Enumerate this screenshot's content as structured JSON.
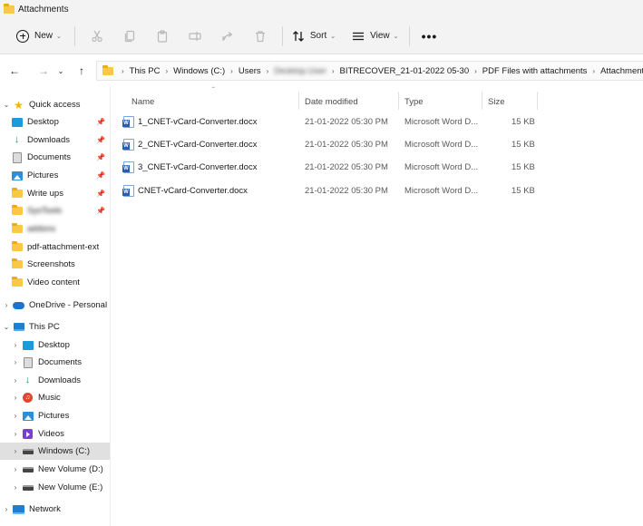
{
  "window": {
    "title": "Attachments"
  },
  "commandbar": {
    "new_label": "New",
    "sort_label": "Sort",
    "view_label": "View",
    "more_label": "•••"
  },
  "address": {
    "crumbs": [
      "This PC",
      "Windows (C:)",
      "Users",
      "Desktop.User",
      "BITRECOVER_21-01-2022 05-30",
      "PDF Files with attachments",
      "Attachments"
    ]
  },
  "nav": {
    "quick_access": "Quick access",
    "quick_items": [
      "Desktop",
      "Downloads",
      "Documents",
      "Pictures",
      "Write ups",
      "SysTools",
      "addons",
      "pdf-attachment-ext",
      "Screenshots",
      "Video content"
    ],
    "onedrive": "OneDrive - Personal",
    "this_pc": "This PC",
    "pc_items": [
      "Desktop",
      "Documents",
      "Downloads",
      "Music",
      "Pictures",
      "Videos",
      "Windows (C:)",
      "New Volume (D:)",
      "New Volume (E:)"
    ],
    "network": "Network"
  },
  "columns": {
    "name": "Name",
    "date": "Date modified",
    "type": "Type",
    "size": "Size"
  },
  "files": [
    {
      "name": "1_CNET-vCard-Converter.docx",
      "date": "21-01-2022 05:30 PM",
      "type": "Microsoft Word D...",
      "size": "15 KB"
    },
    {
      "name": "2_CNET-vCard-Converter.docx",
      "date": "21-01-2022 05:30 PM",
      "type": "Microsoft Word D...",
      "size": "15 KB"
    },
    {
      "name": "3_CNET-vCard-Converter.docx",
      "date": "21-01-2022 05:30 PM",
      "type": "Microsoft Word D...",
      "size": "15 KB"
    },
    {
      "name": "CNET-vCard-Converter.docx",
      "date": "21-01-2022 05:30 PM",
      "type": "Microsoft Word D...",
      "size": "15 KB"
    }
  ],
  "colors": {
    "folder": "#f8c846",
    "selection": "#e0e0e0",
    "word_blue": "#2b5cad"
  }
}
